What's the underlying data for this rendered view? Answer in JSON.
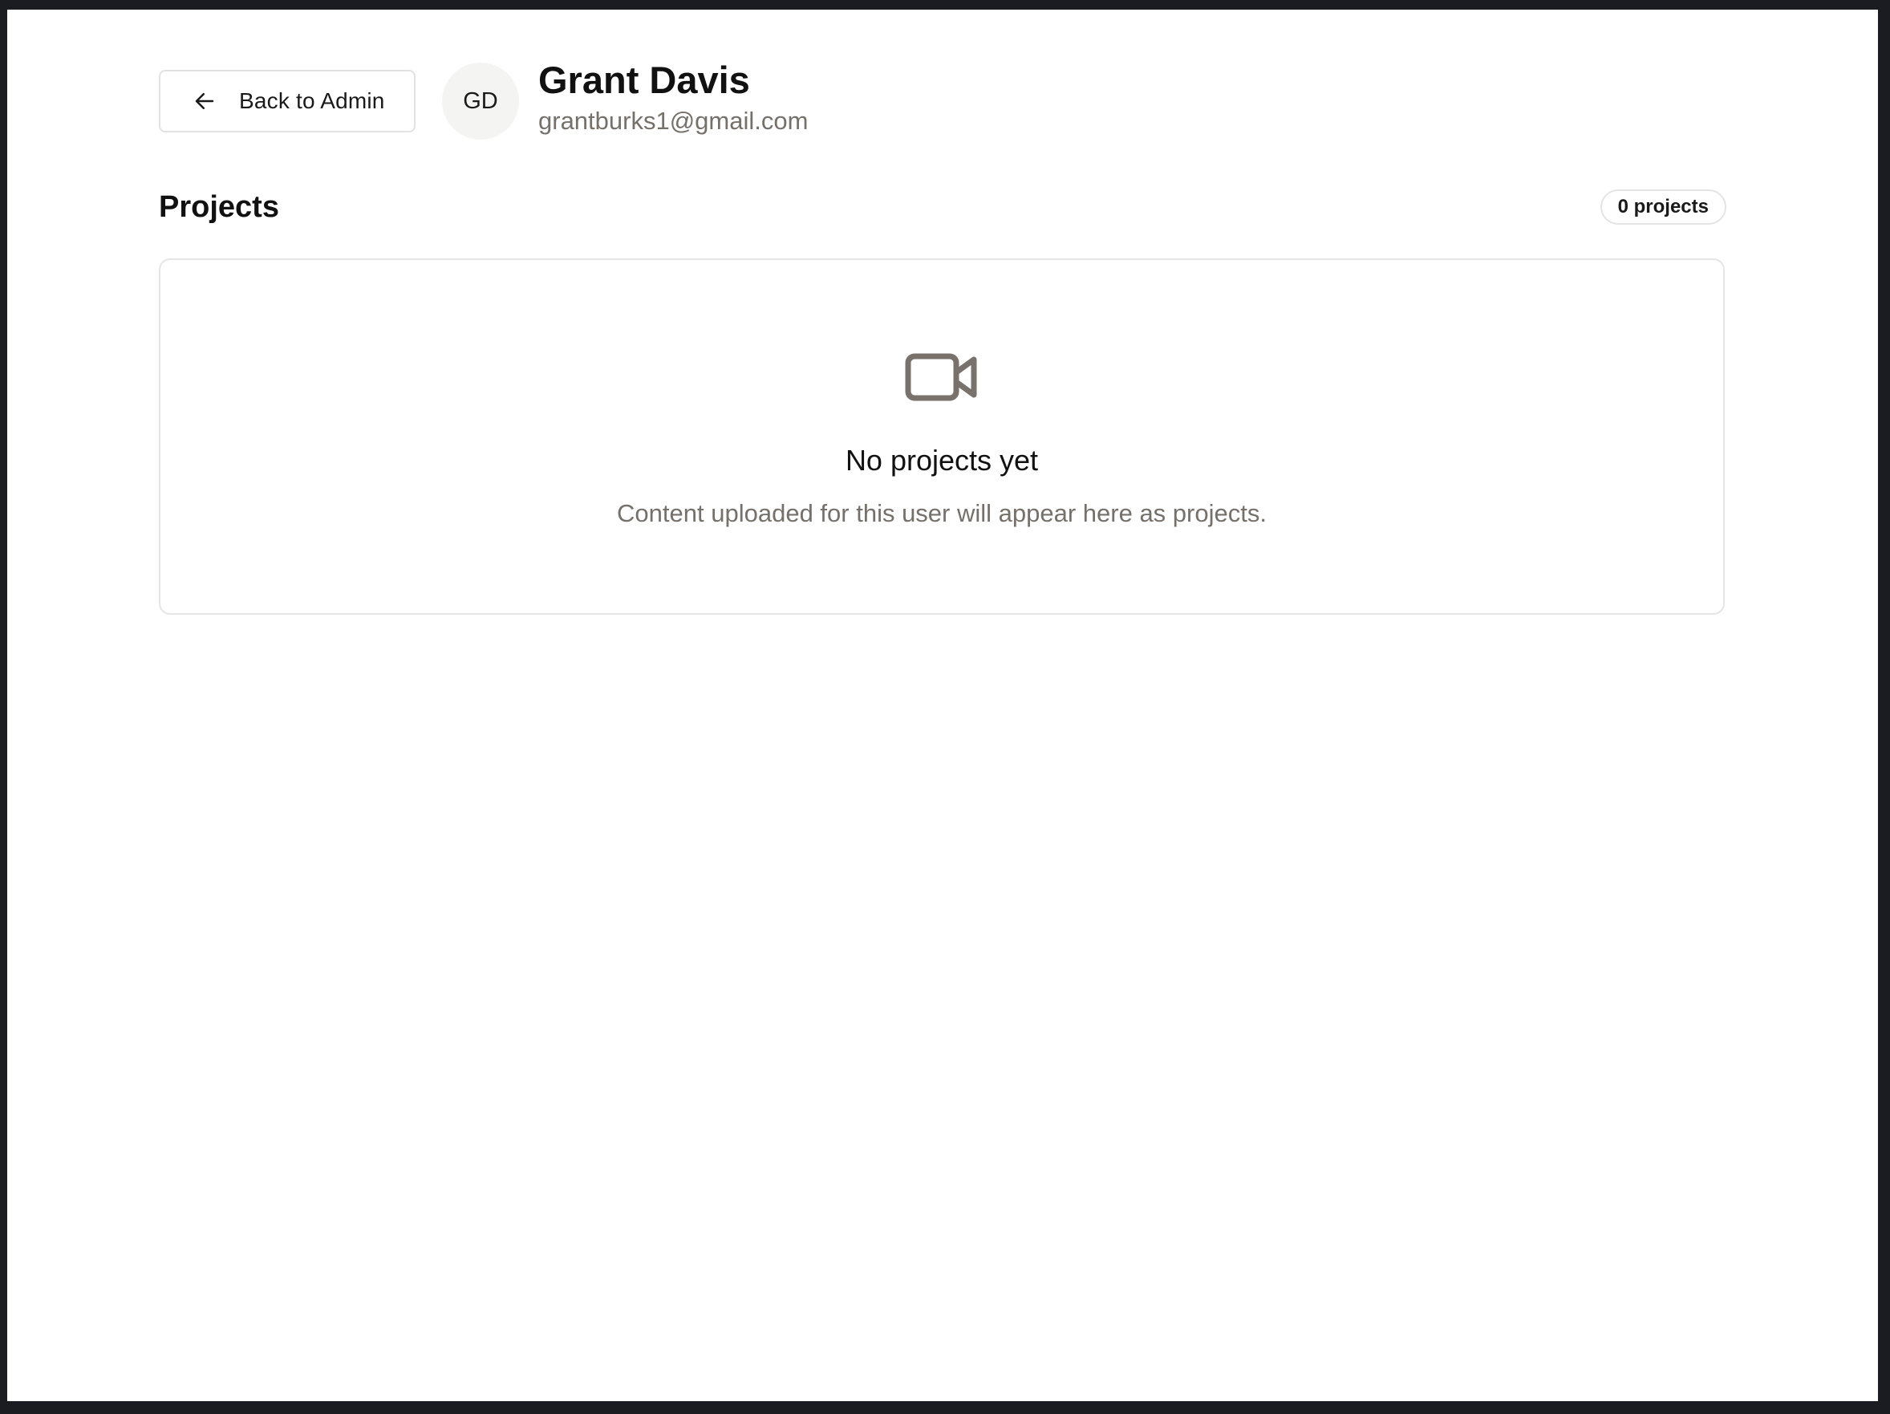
{
  "header": {
    "back_label": "Back to Admin",
    "back_icon": "arrow-left-icon",
    "avatar_initials": "GD",
    "user_name": "Grant Davis",
    "user_email": "grantburks1@gmail.com"
  },
  "projects": {
    "title": "Projects",
    "count_label": "0 projects",
    "empty_icon": "video-camera-icon",
    "empty_title": "No projects yet",
    "empty_description": "Content uploaded for this user will appear here as projects."
  },
  "colors": {
    "frame": "#1a1c21",
    "muted_text": "#76706b",
    "icon": "#78716c",
    "border": "#e5e5e5"
  }
}
